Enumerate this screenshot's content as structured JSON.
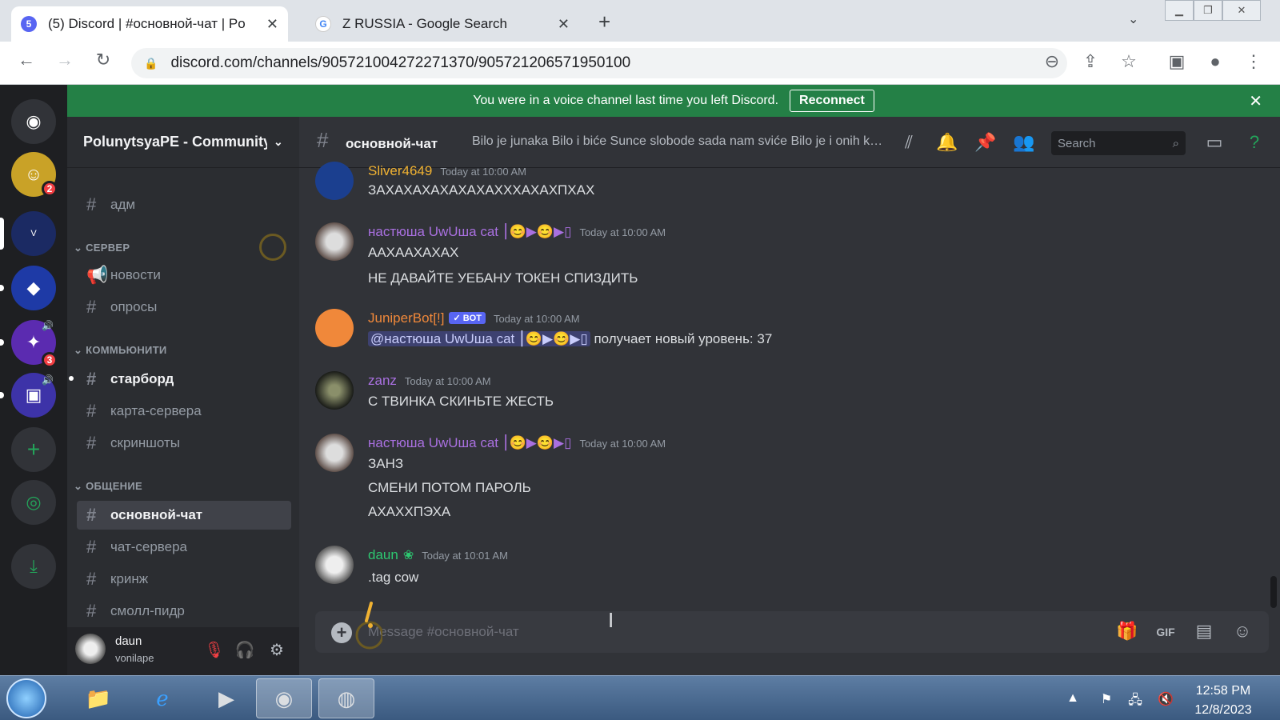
{
  "browser": {
    "tabs": [
      {
        "title": "(5) Discord | #основной-чат | Po",
        "favicon_badge": "5",
        "close": "✕"
      },
      {
        "title": "Z RUSSIA - Google Search",
        "favicon": "G",
        "close": "✕"
      }
    ],
    "new_tab": "+",
    "url": "discord.com/channels/905721004272271370/905721206571950100"
  },
  "notice": {
    "text": "You were in a voice channel last time you left Discord.",
    "button": "Reconnect",
    "close": "✕"
  },
  "guilds": {
    "badges": [
      "2",
      "3"
    ]
  },
  "server": {
    "name": "PolunytsyaPE - Community",
    "top_channel": "адм",
    "categories": [
      {
        "name": "СЕРВЕР",
        "channels": [
          "новости",
          "опросы"
        ]
      },
      {
        "name": "КОММЬЮНИТИ",
        "channels": [
          "старборд",
          "карта-сервера",
          "скриншоты"
        ]
      },
      {
        "name": "ОБЩЕНИЕ",
        "channels": [
          "основной-чат",
          "чат-сервера",
          "кринж",
          "смолл-пидр"
        ]
      }
    ]
  },
  "user": {
    "name": "daun",
    "status": "vonilape"
  },
  "channel": {
    "name": "основной-чат",
    "topic": "Bilo je junaka Bilo i biće Sunce slobode sada nam sviće Bilo je i onih koji...",
    "search_placeholder": "Search"
  },
  "messages": [
    {
      "author": "Sliver4649",
      "time": "Today at 10:00 AM",
      "color": "#f0b232",
      "lines": [
        "ЗАХАХАХАХАХАХАХХХАХАХПХАХ"
      ]
    },
    {
      "author": "настюша UwUша cat ⎮😊▶😊▶▯",
      "time": "Today at 10:00 AM",
      "color": "#a970e0",
      "lines": [
        "ААХААХАХАХ",
        "НЕ ДАВАЙТЕ УЕБАНУ ТОКЕН СПИЗДИТЬ"
      ]
    },
    {
      "author": "JuniperBot[!]",
      "bot_tag": "✓ BOT",
      "time": "Today at 10:00 AM",
      "color": "#f0883a",
      "mention": "@настюша UwUша cat ⎮😊▶😊▶▯",
      "text": "получает новый уровень: 37"
    },
    {
      "author": "zanz",
      "time": "Today at 10:00 AM",
      "color": "#a970e0",
      "lines": [
        "С ТВИНКА СКИНЬТЕ ЖЕСТЬ"
      ]
    },
    {
      "author": "настюша UwUша cat ⎮😊▶😊▶▯",
      "time": "Today at 10:00 AM",
      "color": "#a970e0",
      "lines": [
        "ЗАНЗ",
        "СМЕНИ ПОТОМ ПАРОЛЬ",
        "АХАХХПЭХА"
      ]
    },
    {
      "author": "daun",
      "time": "Today at 10:01 AM",
      "color": "#2dc770",
      "lines": [
        ".tag cow"
      ]
    }
  ],
  "composer": {
    "placeholder": "Message #основной-чат"
  },
  "taskbar": {
    "time": "12:58 PM",
    "date": "12/8/2023"
  }
}
